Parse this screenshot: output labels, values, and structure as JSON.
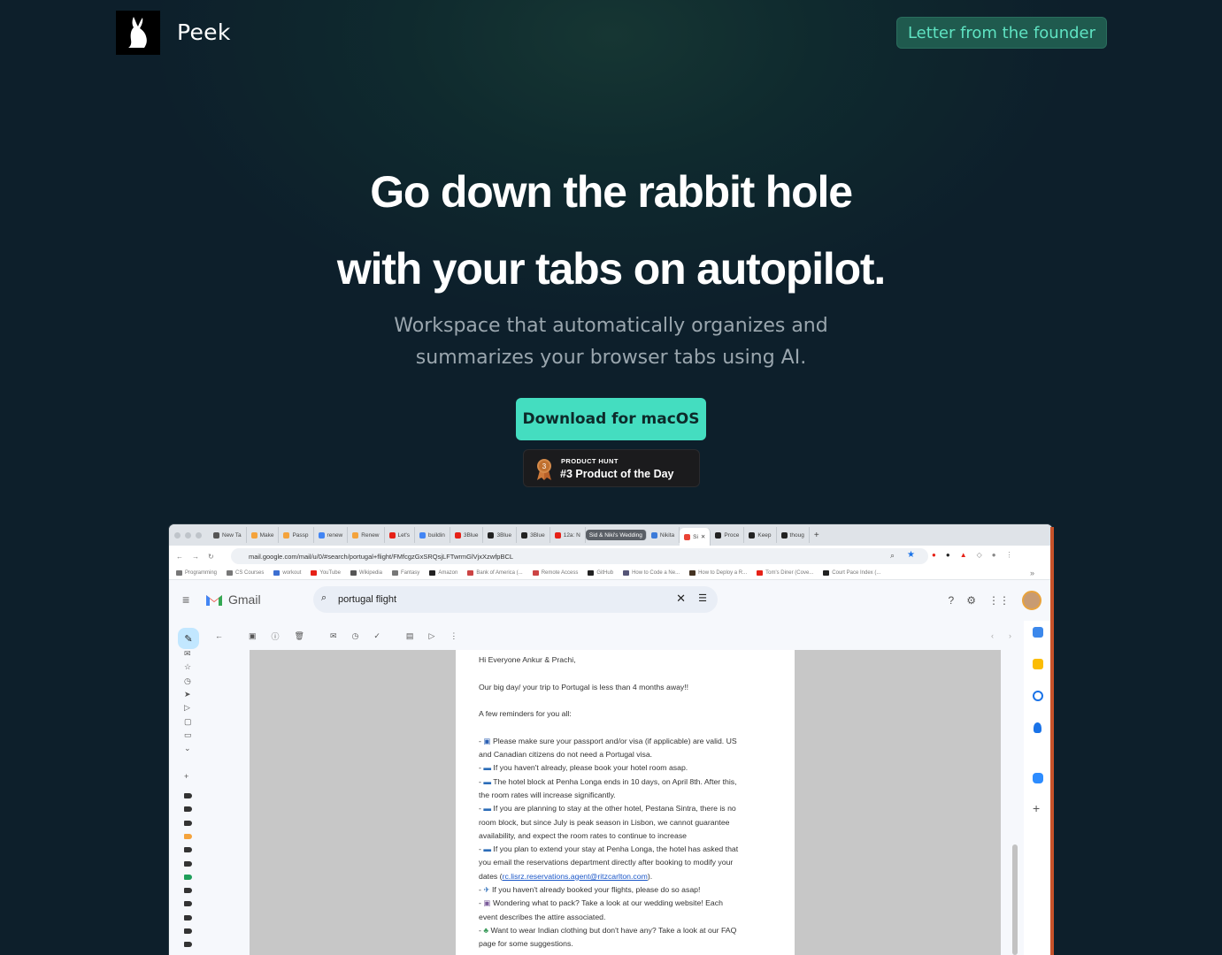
{
  "header": {
    "brand": "Peek",
    "founder_button": "Letter from the founder"
  },
  "hero": {
    "title_line1": "Go down the rabbit hole",
    "title_line2": "with your tabs on autopilot.",
    "subtitle_line1": "Workspace that automatically organizes and",
    "subtitle_line2": "summarizes your browser tabs using AI.",
    "download_button": "Download for macOS",
    "product_hunt": {
      "kicker": "PRODUCT HUNT",
      "label": "#3 Product of the Day",
      "rank": "3"
    }
  },
  "screenshot": {
    "tabs": [
      {
        "label": "New Ta",
        "color": "#555"
      },
      {
        "label": "Make",
        "color": "#f4a33c"
      },
      {
        "label": "Passp",
        "color": "#f4a33c"
      },
      {
        "label": "renew",
        "color": "#4285f4"
      },
      {
        "label": "Renew",
        "color": "#f4a33c"
      },
      {
        "label": "Let's",
        "color": "#e62117"
      },
      {
        "label": "buildin",
        "color": "#4285f4"
      },
      {
        "label": "3Blue",
        "color": "#e62117"
      },
      {
        "label": "3Blue",
        "color": "#222"
      },
      {
        "label": "3Blue",
        "color": "#222"
      },
      {
        "label": "12a: N",
        "color": "#e62117"
      }
    ],
    "tab_group": "Sid & Niki's Wedding",
    "tabs_after": [
      {
        "label": "Nikita",
        "color": "#3c7bd9"
      },
      {
        "label": "Si",
        "color": "#ea4335"
      },
      {
        "label": "Proce",
        "color": "#222"
      },
      {
        "label": "Keep",
        "color": "#222"
      },
      {
        "label": "thoug",
        "color": "#222"
      }
    ],
    "url": "mail.google.com/mail/u/0/#search/portugal+flight/FMfcgzGxSRQsjLFTwrmGlVjxXzwfpBCL",
    "bookmarks": [
      "Programming",
      "CS Courses",
      "workout",
      "YouTube",
      "Wikipedia",
      "Fantasy",
      "Amazon",
      "Bank of America (...",
      "Remote Access",
      "GitHub",
      "How to Code a Ne...",
      "How to Deploy a R...",
      "Tom's Diner (Cove...",
      "Court Pace Index (..."
    ],
    "gmail_label": "Gmail",
    "search_value": "portugal flight",
    "email": {
      "greeting": "Hi Everyone Ankur & Prachi,",
      "intro": "Our big day/ your trip to Portugal is less than 4 months away!!",
      "reminders": "A few reminders for you all:",
      "b1a": "Please make sure your passport and/or visa (if applicable) are valid. US",
      "b1b": "and Canadian citizens do not need a Portugal visa.",
      "b2": "If you haven't already, please book your hotel room asap.",
      "b3a": "The hotel block at Penha Longa ends in 10 days, on April 8th. After this,",
      "b3b": "the room rates will increase significantly.",
      "b4a": "If you are planning to stay at the other hotel, Pestana Sintra, there is no",
      "b4b": "room block, but since July is peak season in Lisbon, we cannot guarantee",
      "b4c": "availability, and expect the room rates to continue to increase",
      "b5a": "If you plan to extend your stay at Penha Longa, the hotel has asked that",
      "b5b": "you email the reservations department directly after booking to modify your",
      "b5c_pre": "dates (",
      "b5c_link": "rc.lisrz.reservations.agent@ritzcarlton.com",
      "b5c_post": ").",
      "b6": "If you haven't already booked your flights, please do so asap!",
      "b7a": "Wondering what to pack? Take a look at our wedding website! Each",
      "b7b": "event describes the attire associated.",
      "b8a": "Want to wear Indian clothing but don't have any? Take a look at our FAQ",
      "b8b": "page for some suggestions."
    }
  }
}
